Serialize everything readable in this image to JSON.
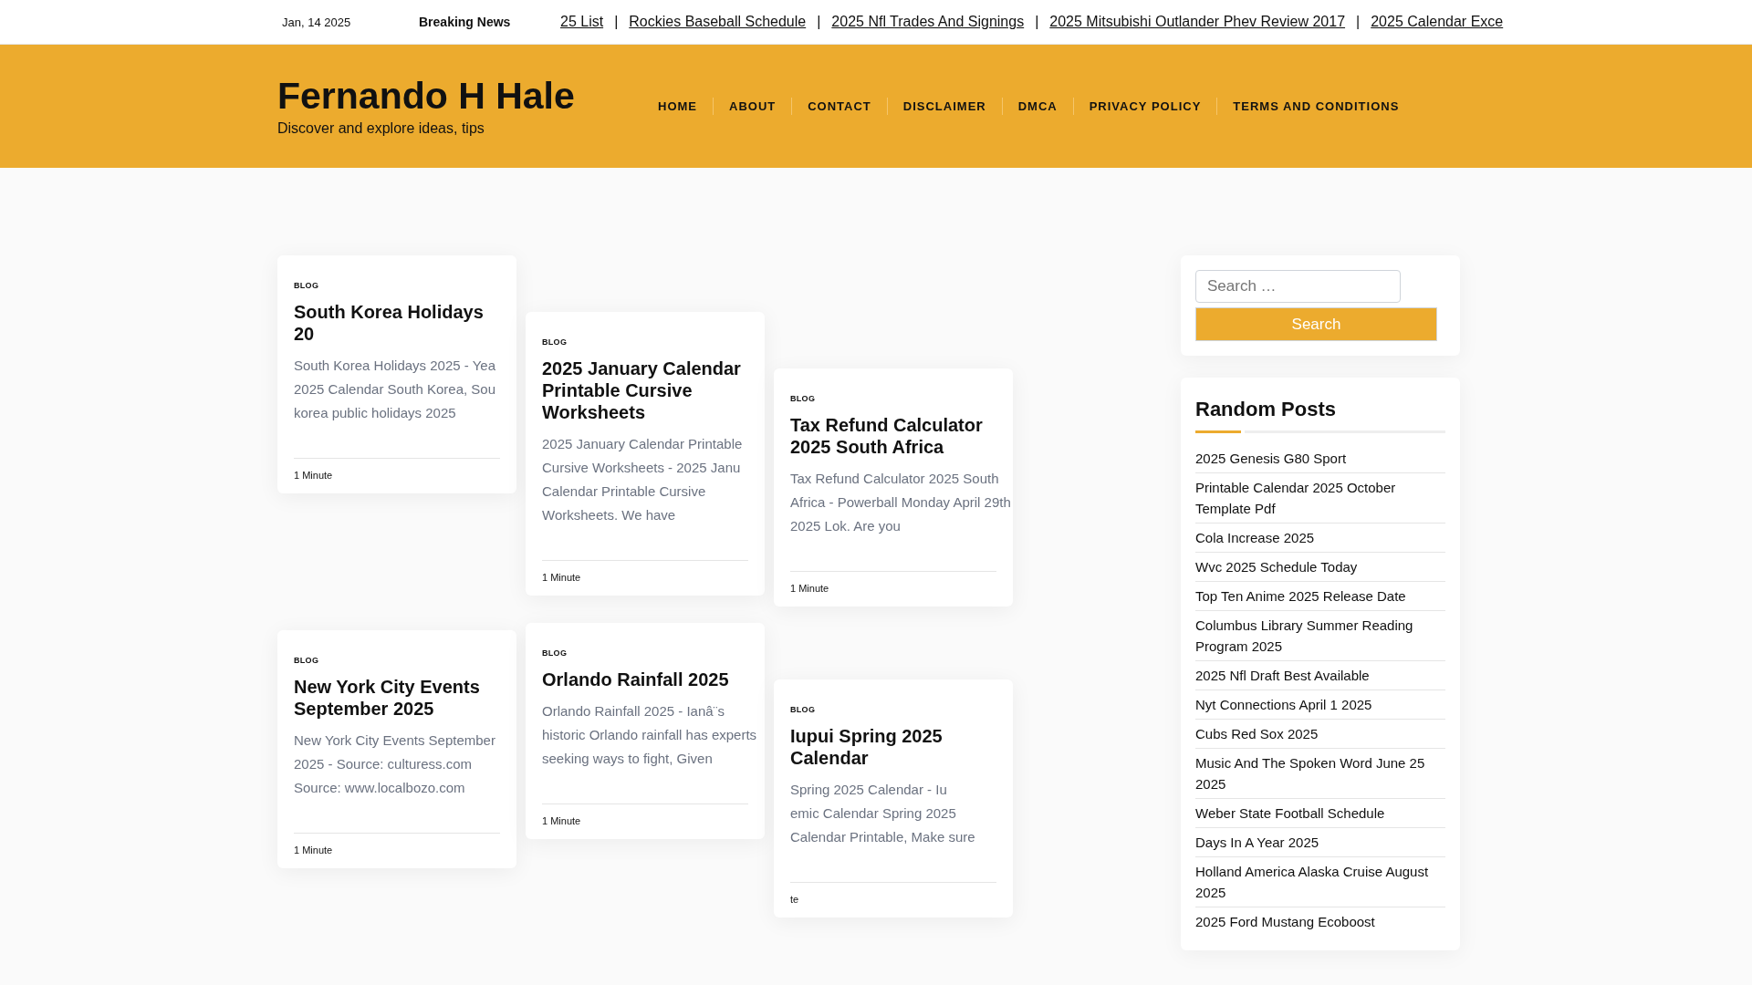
{
  "top_bar": {
    "date": "Jan, 14 2025",
    "ticker": {
      "label": "Breaking News",
      "separator": "|",
      "items": [
        "25 List",
        "Rockies Baseball Schedule",
        "2025 Nfl Trades And Signings",
        "2025 Mitsubishi Outlander Phev Review 2017",
        "2025 Calendar Exce"
      ]
    }
  },
  "header": {
    "site_title": "Fernando H Hale",
    "tagline": "Discover and explore ideas, tips",
    "nav": [
      "HOME",
      "ABOUT",
      "CONTACT",
      "DISCLAIMER",
      "DMCA",
      "PRIVACY POLICY",
      "TERMS AND CONDITIONS"
    ]
  },
  "posts": [
    {
      "category": "BLOG",
      "title": "South Korea Holidays 20",
      "excerpt_lines": [
        "South Korea Holidays 2025 - Yea",
        "2025 Calendar South Korea, Sou",
        "korea public holidays 2025"
      ],
      "meta": "1 Minute"
    },
    {
      "category": "BLOG",
      "title": "2025 January Calendar Printable Cursive Worksheets",
      "excerpt_lines": [
        "2025 January Calendar Printable",
        "Cursive Worksheets - 2025 Janu",
        "Calendar Printable Cursive",
        "Worksheets. We have"
      ],
      "meta": "1 Minute"
    },
    {
      "category": "BLOG",
      "title": "Tax Refund Calculator 2025 South Africa",
      "excerpt_lines": [
        "Tax Refund Calculator 2025 South",
        "Africa - Powerball Monday April 29th",
        "2025 Lok. Are you"
      ],
      "meta": "1 Minute"
    },
    {
      "category": "BLOG",
      "title": "New York City Events September 2025",
      "excerpt_lines": [
        "New York City Events September",
        "2025 - Source: culturess.com",
        "Source: www.localbozo.com"
      ],
      "meta": "1 Minute"
    },
    {
      "category": "BLOG",
      "title": "Orlando Rainfall 2025",
      "excerpt_lines": [
        "Orlando Rainfall 2025 - Ianâ¨s",
        "historic Orlando rainfall has experts",
        "seeking ways to fight, Given"
      ],
      "meta": "1 Minute"
    },
    {
      "category": "BLOG",
      "title": "Iupui Spring 2025 Calendar",
      "excerpt_lines": [
        "Spring 2025 Calendar - Iu",
        "emic Calendar Spring 2025",
        "Calendar Printable, Make sure"
      ],
      "meta": "te"
    }
  ],
  "sidebar": {
    "search": {
      "placeholder": "Search …",
      "button": "Search"
    },
    "random_posts": {
      "title": "Random Posts",
      "items": [
        "2025 Genesis G80 Sport",
        "Printable Calendar 2025 October Template Pdf",
        "Cola Increase 2025",
        "Wvc 2025 Schedule Today",
        "Top Ten Anime 2025 Release Date",
        "Columbus Library Summer Reading Program 2025",
        "2025 Nfl Draft Best Available",
        "Nyt Connections April 1 2025",
        "Cubs Red Sox 2025",
        "Music And The Spoken Word June 25 2025",
        "Weber State Football Schedule",
        "Days In A Year 2025",
        "Holland America Alaska Cruise August 2025",
        "2025 Ford Mustang Ecoboost"
      ]
    }
  }
}
